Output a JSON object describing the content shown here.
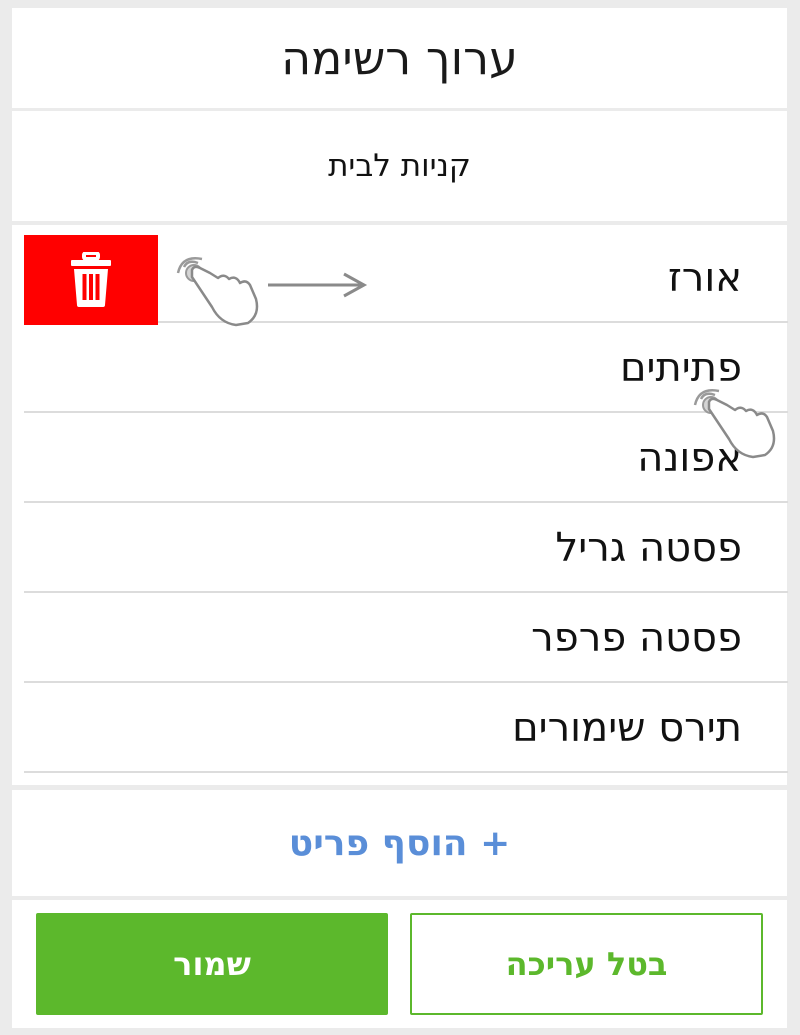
{
  "header": {
    "title": "ערוך רשימה"
  },
  "list": {
    "name": "קניות לבית"
  },
  "items": [
    {
      "label": "אורז"
    },
    {
      "label": "פתיתים"
    },
    {
      "label": "אפונה"
    },
    {
      "label": "פסטה גריל"
    },
    {
      "label": "פסטה פרפר"
    },
    {
      "label": "תירס שימורים"
    }
  ],
  "actions": {
    "add_item": "+ הוסף פריט",
    "save": "שמור",
    "cancel": "בטל עריכה"
  },
  "icons": {
    "delete": "trash-icon",
    "swipe_gesture": "hand-swipe-icon",
    "swipe_direction": "arrow-right-icon",
    "tap_gesture": "hand-tap-icon"
  },
  "colors": {
    "delete_bg": "#ff0000",
    "accent_green": "#5cb82c",
    "link_blue": "#5a8ed8"
  }
}
